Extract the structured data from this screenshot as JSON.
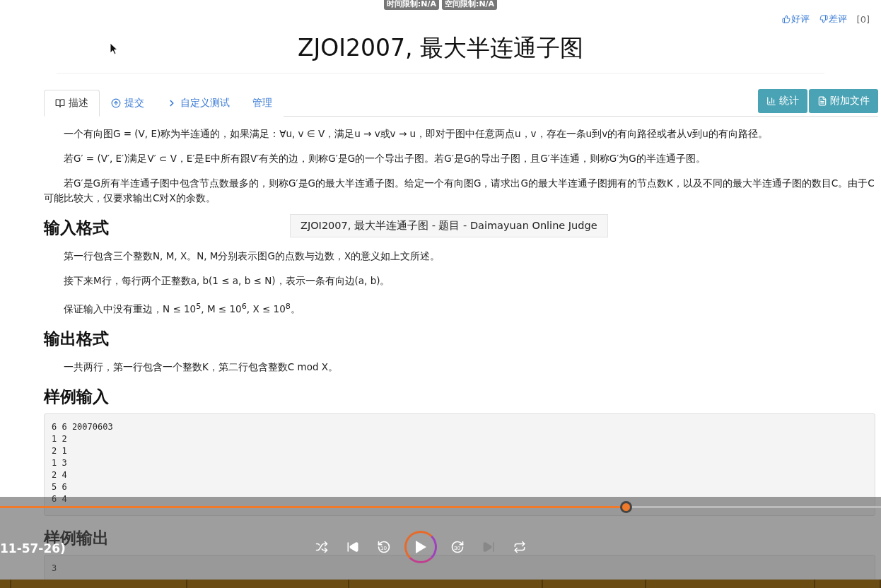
{
  "limits": [
    "时间限制:N/A",
    "空间限制:N/A"
  ],
  "rating": {
    "like": "好评",
    "dislike": "差评",
    "count": "[0]"
  },
  "title": "ZJOI2007, 最大半连通子图",
  "tabs": [
    {
      "label": "描述",
      "selected": true,
      "kind": "book"
    },
    {
      "label": "提交",
      "selected": false,
      "kind": "upload"
    },
    {
      "label": "自定义测试",
      "selected": false,
      "kind": "terminal"
    },
    {
      "label": "管理",
      "selected": false,
      "kind": "plain"
    }
  ],
  "actions": [
    {
      "label": "统计",
      "kind": "chart"
    },
    {
      "label": "附加文件",
      "kind": "file"
    }
  ],
  "description": [
    "一个有向图G = (V, E)称为半连通的，如果满足：∀u, v ∈ V，满足u → v或v → u，即对于图中任意两点u，v，存在一条u到v的有向路径或者从v到u的有向路径。",
    "若G′ = (V′, E′)满足V′ ⊂ V，E′是E中所有跟V′有关的边，则称G′是G的一个导出子图。若G′是G的导出子图，且G′半连通，则称G′为G的半连通子图。",
    "若G′是G所有半连通子图中包含节点数最多的，则称G′是G的最大半连通子图。给定一个有向图G，请求出G的最大半连通子图拥有的节点数K，以及不同的最大半连通子图的数目C。由于C可能比较大，仅要求输出C对X的余数。"
  ],
  "sections": [
    {
      "heading": "输入格式",
      "paragraphs": [
        "第一行包含三个整数N, M, X。N, M分别表示图G的点数与边数，X的意义如上文所述。",
        "接下来M行，每行两个正整数a, b(1 ≤ a, b ≤ N)，表示一条有向边(a, b)。",
        "保证输入中没有重边，N ≤ 10$^{5}$, M ≤ 10$^{6}$, X ≤ 10$^{8}$。"
      ]
    },
    {
      "heading": "输出格式",
      "paragraphs": [
        "一共两行，第一行包含一个整数K，第二行包含整数C mod X。"
      ]
    }
  ],
  "samples": [
    {
      "heading": "样例输入",
      "lines": [
        "6 6 20070603",
        "1 2",
        "2 1",
        "1 3",
        "2 4",
        "5 6",
        "6 4"
      ]
    },
    {
      "heading": "样例输出",
      "lines": [
        "3"
      ]
    }
  ],
  "tooltip": "ZJOI2007, 最大半连通子图 - 题目 - Daimayuan Online Judge",
  "player": {
    "time": "11-57-26)",
    "level": 0.71,
    "controls": [
      {
        "kind": "shuffle",
        "disabled": false
      },
      {
        "kind": "previous",
        "disabled": false
      },
      {
        "kind": "rewind",
        "label": "10",
        "disabled": false
      },
      {
        "kind": "play",
        "disabled": false
      },
      {
        "kind": "forward",
        "label": "30",
        "disabled": false
      },
      {
        "kind": "next",
        "disabled": true
      },
      {
        "kind": "repeat",
        "disabled": false
      }
    ]
  }
}
